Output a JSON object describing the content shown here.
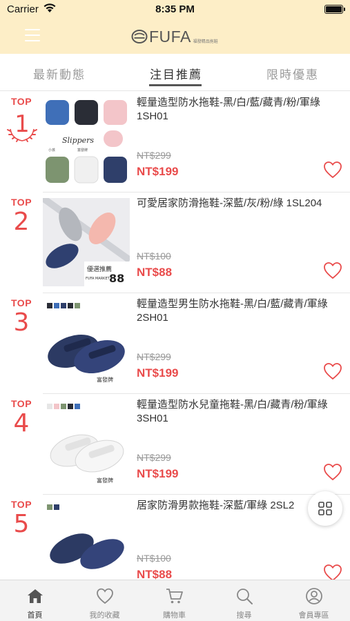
{
  "status_bar": {
    "carrier": "Carrier",
    "time": "8:35 PM"
  },
  "header": {
    "brand": "FUFA",
    "brand_sub": "福發精品拖鞋",
    "background": "#fdeec7"
  },
  "tabs": [
    {
      "label": "最新動態",
      "active": false
    },
    {
      "label": "注目推薦",
      "active": true
    },
    {
      "label": "限時優惠",
      "active": false
    }
  ],
  "products": [
    {
      "top_label": "TOP",
      "rank": "1",
      "title": "輕量造型防水拖鞋-黑/白/藍/藏青/粉/軍綠 1SH01",
      "original_price": "NT$299",
      "price": "NT$199",
      "image_text": [
        "Slippers",
        "小孩",
        "富發牌"
      ]
    },
    {
      "top_label": "TOP",
      "rank": "2",
      "title": "可愛居家防滑拖鞋-深藍/灰/粉/綠 1SL204",
      "original_price": "NT$100",
      "price": "NT$88",
      "image_text": [
        "優選推薦",
        "FUFA MARKET",
        "88"
      ]
    },
    {
      "top_label": "TOP",
      "rank": "3",
      "title": "輕量造型男生防水拖鞋-黑/白/藍/藏青/軍綠 2SH01",
      "original_price": "NT$299",
      "price": "NT$199",
      "image_text": [
        "富發牌"
      ]
    },
    {
      "top_label": "TOP",
      "rank": "4",
      "title": "輕量造型防水兒童拖鞋-黑/白/藏青/粉/軍綠 3SH01",
      "original_price": "NT$299",
      "price": "NT$199",
      "image_text": [
        "富發牌"
      ]
    },
    {
      "top_label": "TOP",
      "rank": "5",
      "title": "居家防滑男款拖鞋-深藍/軍綠 2SL2",
      "original_price": "NT$100",
      "price": "NT$88",
      "image_text": []
    }
  ],
  "bottom_nav": [
    {
      "label": "首頁",
      "icon": "home-icon",
      "active": true
    },
    {
      "label": "我的收藏",
      "icon": "heart-icon",
      "active": false
    },
    {
      "label": "購物車",
      "icon": "cart-icon",
      "active": false
    },
    {
      "label": "搜尋",
      "icon": "search-icon",
      "active": false
    },
    {
      "label": "會員專區",
      "icon": "user-icon",
      "active": false
    }
  ],
  "colors": {
    "accent_red": "#e94b4b",
    "header_bg": "#fdeec7",
    "heart": "#e94b4b"
  }
}
